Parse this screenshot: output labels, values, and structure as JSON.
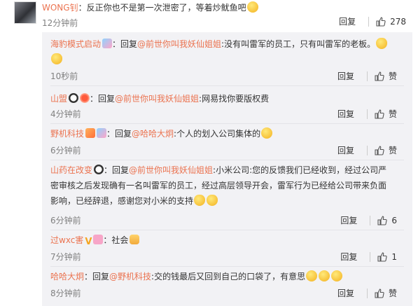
{
  "top_comment": {
    "username": "WONG钊",
    "text": "：反正你也不是第一次泄密了，等着炒鱿鱼吧",
    "time": "12分钟前",
    "reply_label": "回复",
    "like_count": "278"
  },
  "replies": [
    {
      "username": "海豹模式启动",
      "pre": "：回复",
      "mention": "@前世你叫我妖仙姐姐",
      "text": ":没有叫雷军的员工，只有叫雷军的老板。",
      "time": "10秒前",
      "reply_label": "回复",
      "like_label": "赞"
    },
    {
      "username": "山盟",
      "pre": "：回复",
      "mention": "@前世你叫我妖仙姐姐",
      "text": ":网易找你要版权费",
      "time": "4分钟前",
      "reply_label": "回复",
      "like_label": "赞"
    },
    {
      "username": "野机科技",
      "pre": "：回复",
      "mention": "@哈哈大炯",
      "text": ":个人的划入公司集体的",
      "time": "6分钟前",
      "reply_label": "回复",
      "like_label": "赞"
    },
    {
      "username": "山药在改变",
      "pre": "：回复",
      "mention": "@前世你叫我妖仙姐姐",
      "text": ":小米公司:您的反馈我们已经收到，经过公司严密审核之后发现确有一名叫雷军的员工，经过高层领导开会，雷军行为已经给公司带来负面影响，已经辞退，感谢您对小米的支持",
      "time": "6分钟前",
      "reply_label": "回复",
      "like_label": "6"
    },
    {
      "username": "过wxc害",
      "pre": "：",
      "mention": "",
      "text": "社会",
      "time": "7分钟前",
      "reply_label": "回复",
      "like_label": "1"
    },
    {
      "username": "哈哈大炯",
      "pre": "：回复",
      "mention": "@野机科技",
      "text": ":交的钱最后又回到自己的口袋了，有意思",
      "time": "8分钟前",
      "reply_label": "回复",
      "like_label": "赞"
    }
  ],
  "icons": {
    "like": "thumbs-up-icon"
  },
  "colors": {
    "username": "#eb7350",
    "panel_bg": "#f2f2f5",
    "time": "#808080"
  }
}
